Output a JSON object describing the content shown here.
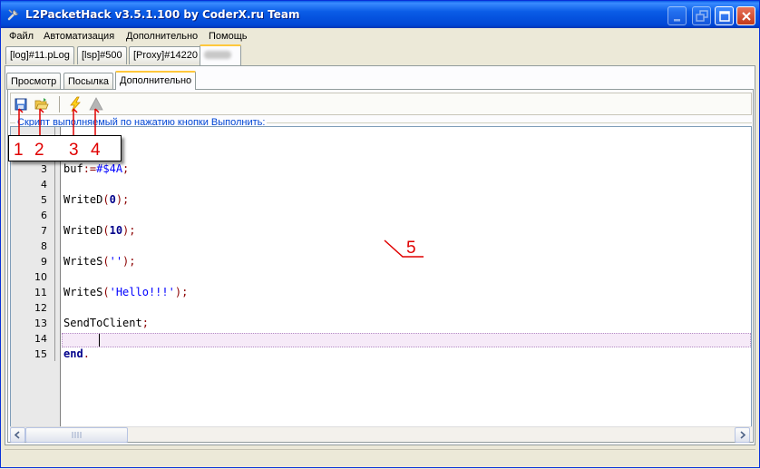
{
  "window": {
    "title": "L2PacketHack v3.5.1.100 by CoderX.ru Team",
    "icon": "wrench-icon"
  },
  "menubar": {
    "items": [
      {
        "label": "Файл"
      },
      {
        "label": "Автоматизация"
      },
      {
        "label": "Дополнительно"
      },
      {
        "label": "Помощь"
      }
    ]
  },
  "connection_tabs": [
    {
      "label": "[log]#11.pLog",
      "active": false
    },
    {
      "label": "[lsp]#500",
      "active": false
    },
    {
      "label": "[Proxy]#14220",
      "active": false
    },
    {
      "label": "",
      "active": true,
      "blurred": true
    }
  ],
  "sub_tabs": [
    {
      "label": "Просмотр",
      "active": false
    },
    {
      "label": "Посылка",
      "active": false
    },
    {
      "label": "Дополнительно",
      "active": true
    }
  ],
  "toolbar": {
    "buttons": [
      {
        "icon": "save-icon"
      },
      {
        "icon": "open-folder-icon"
      },
      {
        "icon": "lightning-run-icon"
      },
      {
        "icon": "stop-triangle-icon"
      }
    ]
  },
  "script_group": {
    "label": "Скрипт выполняемый по нажатию кнопки Выполнить:"
  },
  "editor": {
    "line_numbers": [
      "3",
      "4",
      "5",
      "6",
      "7",
      "8",
      "9",
      "10",
      "11",
      "12",
      "13",
      "14",
      "15"
    ],
    "lines": {
      "l3": {
        "ident": "buf",
        "op": ":=",
        "hex": "#$4A",
        "end": ";"
      },
      "l5": {
        "fn": "WriteD",
        "open": "(",
        "arg": "0",
        "close": ");"
      },
      "l7": {
        "fn": "WriteD",
        "open": "(",
        "arg": "10",
        "close": ");"
      },
      "l9": {
        "fn": "WriteS",
        "open": "(",
        "arg": "''",
        "close": ");"
      },
      "l11": {
        "fn": "WriteS",
        "open": "(",
        "arg": "'Hello!!!'",
        "close": ");"
      },
      "l13": {
        "fn": "SendToClient",
        "end": ";"
      },
      "l15": {
        "kw": "end",
        "end": "."
      }
    },
    "current_line": "14"
  },
  "annotations": {
    "callouts": [
      "1",
      "2",
      "3",
      "4"
    ],
    "editor_label": "5",
    "color": "#e00000"
  }
}
